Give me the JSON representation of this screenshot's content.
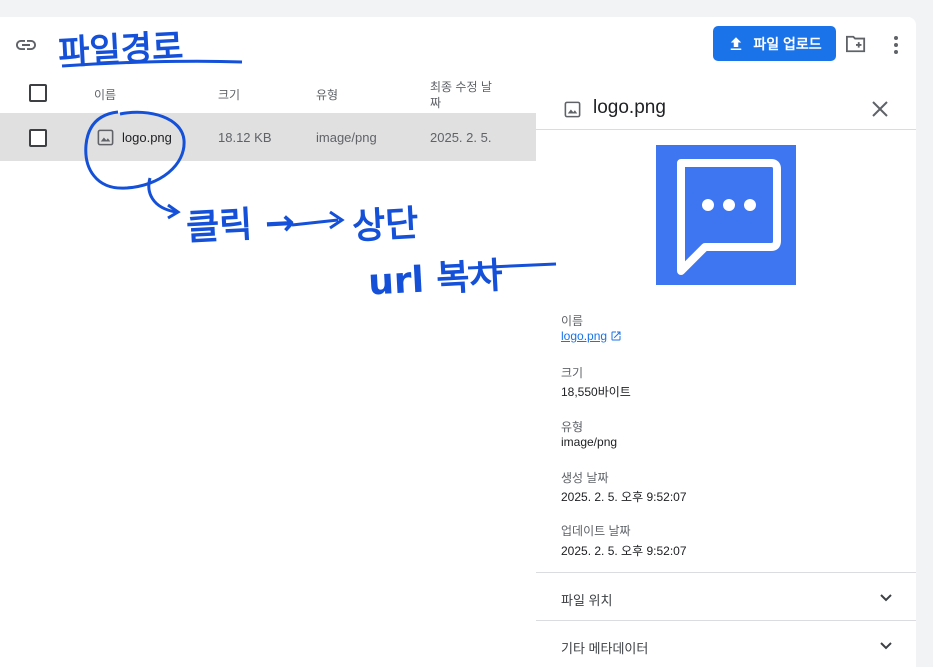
{
  "toolbar": {
    "upload_label": "파일 업로드"
  },
  "table": {
    "headers": {
      "name": "이름",
      "size": "크기",
      "type": "유형",
      "modified_line1": "최종 수정 날",
      "modified_line2": "짜"
    },
    "rows": [
      {
        "name": "logo.png",
        "size": "18.12 KB",
        "type": "image/png",
        "modified": "2025. 2. 5."
      }
    ]
  },
  "panel": {
    "title": "logo.png",
    "name_label": "이름",
    "name_value": "logo.png",
    "size_label": "크기",
    "size_value": "18,550바이트",
    "type_label": "유형",
    "type_value": "image/png",
    "created_label": "생성 날짜",
    "created_value": "2025. 2. 5. 오후 9:52:07",
    "updated_label": "업데이트 날짜",
    "updated_value": "2025. 2. 5. 오후 9:52:07",
    "sections": [
      {
        "label": "파일 위치"
      },
      {
        "label": "기타 메타데이터"
      }
    ]
  },
  "annotations": {
    "top_note": "파일경로",
    "click_note": "클릭 →",
    "top_word": "상단",
    "copy_note": "url 복사"
  },
  "colors": {
    "accent": "#1a73e8",
    "annotation": "#1450d8",
    "preview_bg": "#3d76f0",
    "row_selected": "#e0e0e0"
  }
}
